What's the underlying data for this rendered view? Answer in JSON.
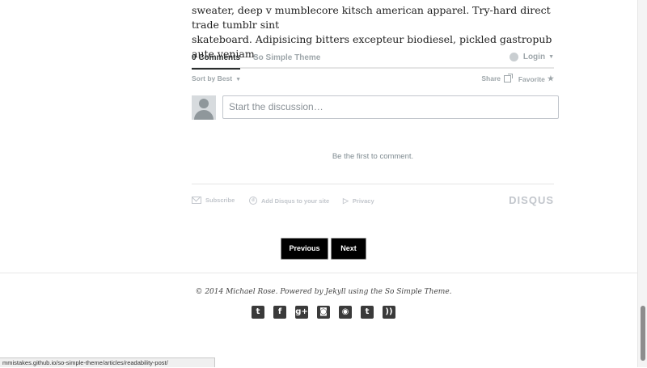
{
  "article": {
    "line1": "sweater, deep v mumblecore kitsch american apparel. Try-hard direct trade tumblr sint",
    "line2": "skateboard. Adipisicing bitters excepteur biodiesel, pickled gastropub aute veniam."
  },
  "disqus": {
    "tabs": {
      "comments": "0 Comments",
      "forum": "So Simple Theme"
    },
    "login": "Login",
    "sort": "Sort by Best",
    "share": "Share",
    "favorite": "Favorite",
    "placeholder": "Start the discussion…",
    "empty": "Be the first to comment.",
    "footer": {
      "subscribe": "Subscribe",
      "add": "Add Disqus to your site",
      "privacy": "Privacy",
      "logo": "DISQUS"
    }
  },
  "pagination": {
    "previous": "Previous",
    "next": "Next"
  },
  "footer": {
    "copyright": "© 2014 Michael Rose. Powered by Jekyll using the So Simple Theme.",
    "social": [
      "twitter-icon",
      "facebook-icon",
      "google-plus-icon",
      "instagram-icon",
      "github-icon",
      "tumblr-icon",
      "rss-icon"
    ]
  },
  "statusbar": {
    "url": "mmistakes.github.io/so-simple-theme/articles/readability-post/"
  }
}
